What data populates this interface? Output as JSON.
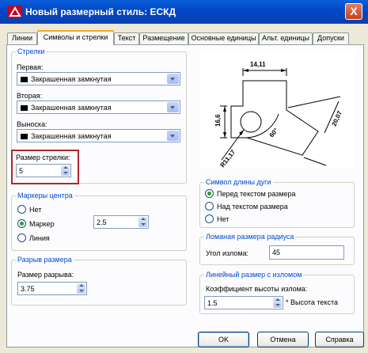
{
  "window": {
    "title": "Новый размерный стиль: ЕСКД",
    "close_label": "X"
  },
  "tabs": [
    {
      "label": "Линии"
    },
    {
      "label": "Символы и стрелки"
    },
    {
      "label": "Текст"
    },
    {
      "label": "Размещение"
    },
    {
      "label": "Основные единицы"
    },
    {
      "label": "Альт. единицы"
    },
    {
      "label": "Допуски"
    }
  ],
  "arrows": {
    "legend": "Стрелки",
    "first_label": "Первая:",
    "first_value": "Закрашенная замкнутая",
    "second_label": "Вторая:",
    "second_value": "Закрашенная замкнутая",
    "leader_label": "Выноска:",
    "leader_value": "Закрашенная замкнутая",
    "size_label": "Размер стрелки:",
    "size_value": "5"
  },
  "center_marks": {
    "legend": "Маркеры центра",
    "options": [
      "Нет",
      "Маркер",
      "Линия"
    ],
    "selected": "Маркер",
    "size_value": "2.5"
  },
  "dim_break": {
    "legend": "Разрыв размера",
    "size_label": "Размер разрыва:",
    "size_value": "3.75"
  },
  "arc_length": {
    "legend": "Символ длины дуги",
    "options": [
      "Перед текстом размера",
      "Над текстом размера",
      "Нет"
    ],
    "selected": "Перед текстом размера"
  },
  "radius_jog": {
    "legend": "Ломаная размера радиуса",
    "angle_label": "Угол излома:",
    "angle_value": "45"
  },
  "linear_jog": {
    "legend": "Линейный размер с изломом",
    "factor_label": "Коэффициент высоты излома:",
    "factor_value": "1.5",
    "suffix": "* Высота текста"
  },
  "preview": {
    "dim_top": "14,11",
    "dim_left": "16,6",
    "dim_right": "20,07",
    "dim_angle": "60°",
    "dim_radius": "R11,17"
  },
  "buttons": {
    "ok": "OK",
    "cancel": "Отмена",
    "help": "Справка"
  },
  "colors": {
    "titlebar": "#0050d0",
    "legend_text": "#0046d5",
    "highlight_box": "#b1262b",
    "preview_lines": "#000000"
  }
}
